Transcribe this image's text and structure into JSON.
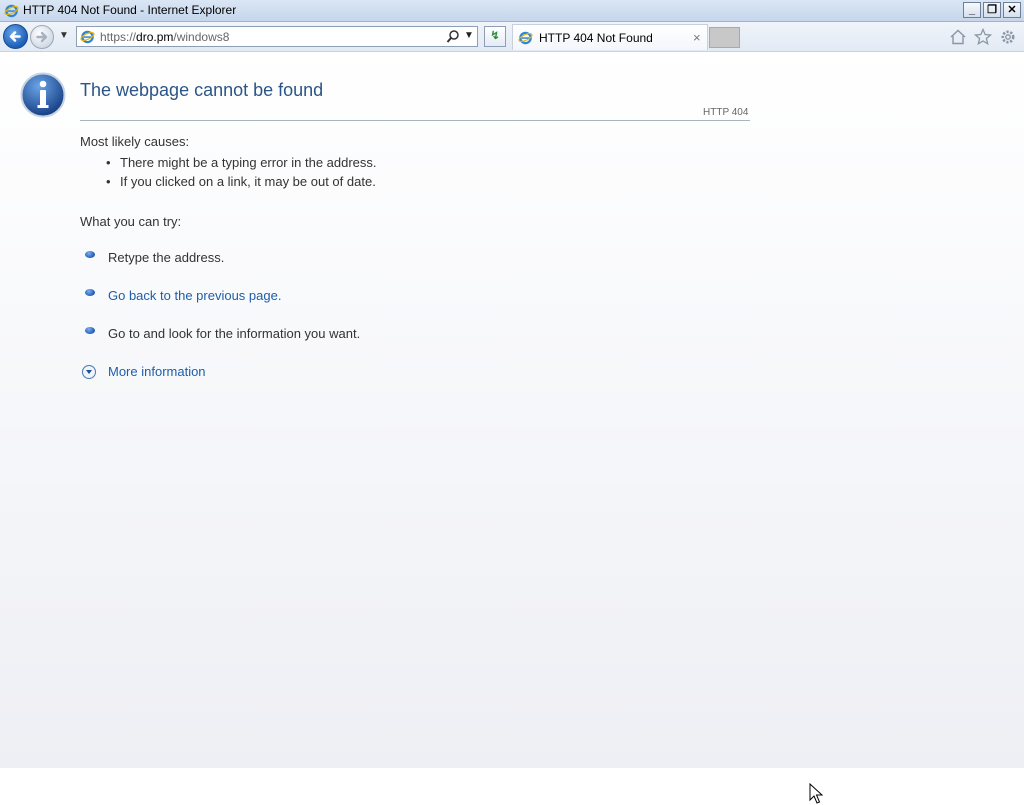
{
  "window": {
    "title": "HTTP 404 Not Found - Internet Explorer"
  },
  "address_bar": {
    "url_prefix": "https://",
    "url_domain": "dro.pm",
    "url_path": "/windows8"
  },
  "tab": {
    "label": "HTTP 404 Not Found",
    "close": "×"
  },
  "error": {
    "heading": "The webpage cannot be found",
    "code": "HTTP 404",
    "causes_title": "Most likely causes:",
    "causes": [
      "There might be a typing error in the address.",
      "If you clicked on a link, it may be out of date."
    ],
    "try_title": "What you can try:",
    "try_items": [
      "Retype the address.",
      "Go back to the previous page.",
      "Go to  and look for the information you want."
    ],
    "more_info": "More information"
  },
  "icons": {
    "app": "ie-logo-icon",
    "back": "back-arrow-icon",
    "forward": "forward-arrow-icon",
    "search": "search-icon",
    "home": "home-icon",
    "favorites": "star-icon",
    "tools": "gear-icon",
    "info": "info-icon"
  }
}
